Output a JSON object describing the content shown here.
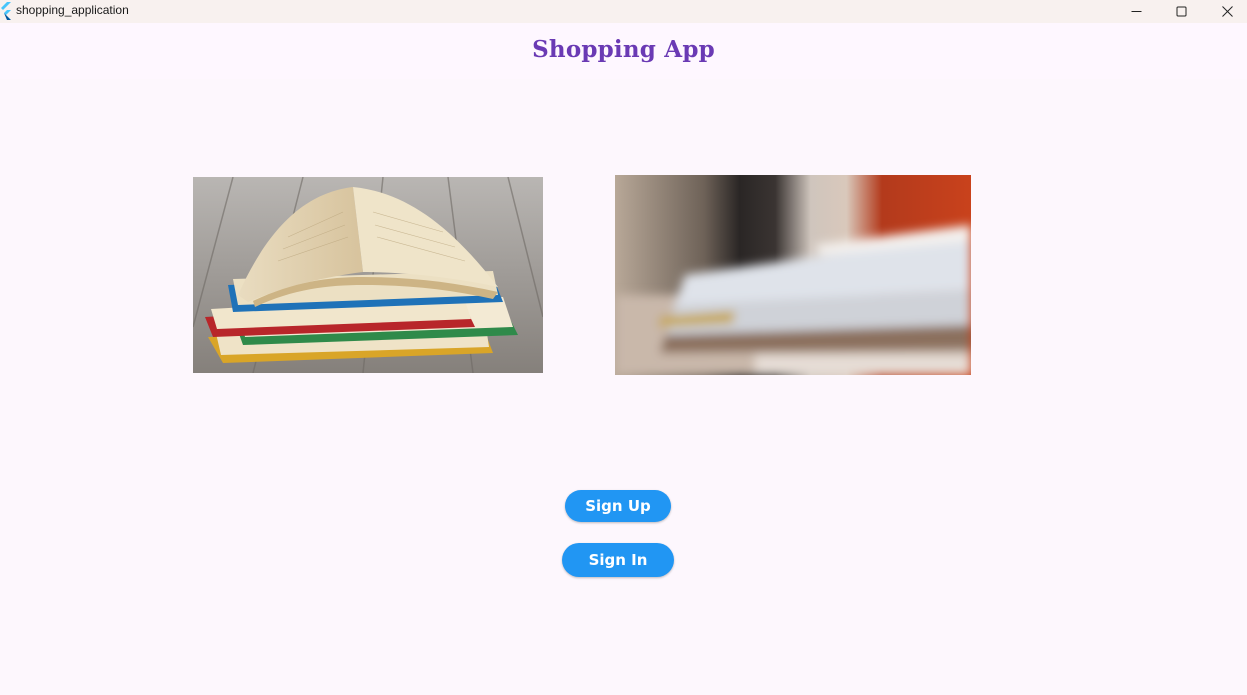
{
  "window": {
    "title": "shopping_application",
    "app_icon": "flutter-icon",
    "controls": [
      "minimize-icon",
      "maximize-icon",
      "close-icon"
    ]
  },
  "appbar": {
    "title": "Shopping App",
    "title_color": "#6a3ab4"
  },
  "images": [
    {
      "name": "open-books-stack-photo"
    },
    {
      "name": "blurred-books-photo"
    }
  ],
  "actions": {
    "signup_label": "Sign Up",
    "signin_label": "Sign In",
    "button_color": "#2196f3"
  },
  "colors": {
    "background": "#fdf7fd",
    "titlebar": "#f8f1ef"
  }
}
